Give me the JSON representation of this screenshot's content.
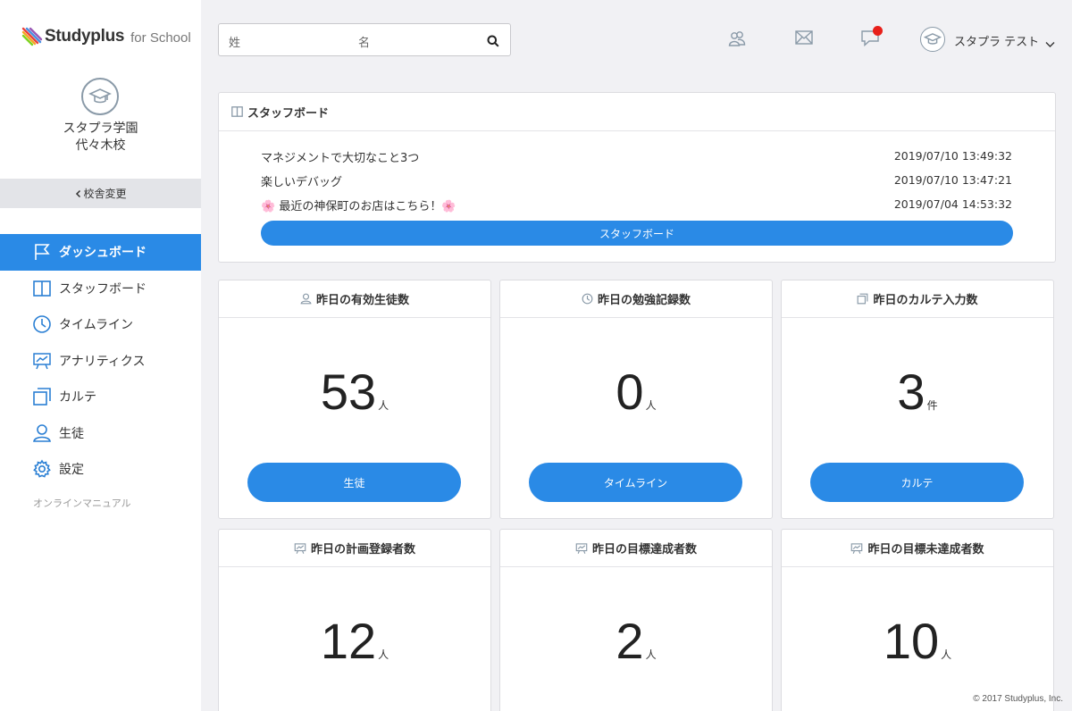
{
  "brand": {
    "name": "Studyplus",
    "sub": "for School"
  },
  "school": {
    "line1": "スタプラ学園",
    "line2": "代々木校",
    "switch_label": "校舎変更"
  },
  "sidebar": {
    "items": [
      {
        "label": "ダッシュボード",
        "icon": "flag-icon",
        "active": true
      },
      {
        "label": "スタッフボード",
        "icon": "board-icon"
      },
      {
        "label": "タイムライン",
        "icon": "clock-icon"
      },
      {
        "label": "アナリティクス",
        "icon": "presentation-icon"
      },
      {
        "label": "カルテ",
        "icon": "copy-icon"
      },
      {
        "label": "生徒",
        "icon": "person-icon"
      },
      {
        "label": "設定",
        "icon": "gear-icon"
      }
    ],
    "manual_link": "オンラインマニュアル"
  },
  "search": {
    "last_name_placeholder": "姓",
    "first_name_placeholder": "名"
  },
  "header": {
    "user_name": "スタプラ テスト",
    "has_notification": true
  },
  "staff_board": {
    "title": "スタッフボード",
    "posts": [
      {
        "title": "マネジメントで大切なこと3つ",
        "date": "2019/07/10 13:49:32"
      },
      {
        "title": "楽しいデバッグ",
        "date": "2019/07/10 13:47:21"
      },
      {
        "title": "🌸 最近の神保町のお店はこちら！🌸",
        "date": "2019/07/04 14:53:32"
      }
    ],
    "button_label": "スタッフボード"
  },
  "cards": [
    {
      "title": "昨日の有効生徒数",
      "icon": "person-icon",
      "value": "53",
      "unit": "人",
      "button": "生徒"
    },
    {
      "title": "昨日の勉強記録数",
      "icon": "clock-icon",
      "value": "0",
      "unit": "人",
      "button": "タイムライン"
    },
    {
      "title": "昨日のカルテ入力数",
      "icon": "copy-icon",
      "value": "3",
      "unit": "件",
      "button": "カルテ"
    },
    {
      "title": "昨日の計画登録者数",
      "icon": "presentation-icon",
      "value": "12",
      "unit": "人"
    },
    {
      "title": "昨日の目標達成者数",
      "icon": "presentation-icon",
      "value": "2",
      "unit": "人"
    },
    {
      "title": "昨日の目標未達成者数",
      "icon": "presentation-icon",
      "value": "10",
      "unit": "人"
    }
  ],
  "footer": "© 2017 Studyplus, Inc.",
  "colors": {
    "accent": "#2a8ae6",
    "notification": "#e8201a",
    "background": "#f1f1f4"
  }
}
